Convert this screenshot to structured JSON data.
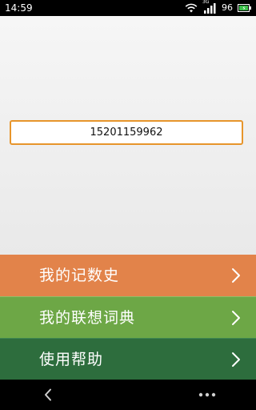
{
  "status_bar": {
    "time": "14:59",
    "signal_label": "3G",
    "battery_level": "96"
  },
  "phone_input": {
    "value": "15201159962"
  },
  "menu": {
    "items": [
      {
        "label": "我的记数史",
        "color": "#e2834a"
      },
      {
        "label": "我的联想词典",
        "color": "#6da746"
      },
      {
        "label": "使用帮助",
        "color": "#2d6d3d"
      }
    ]
  },
  "icons": {
    "status": [
      "wifi-icon",
      "signal-icon",
      "battery-icon"
    ],
    "menu_arrow": "chevron-right-icon",
    "nav": [
      "back-icon",
      "more-icon"
    ]
  },
  "colors": {
    "input_border": "#e7952b",
    "status_bar": "#000000",
    "nav_bar": "#000000",
    "battery_fill": "#3cc04a"
  }
}
